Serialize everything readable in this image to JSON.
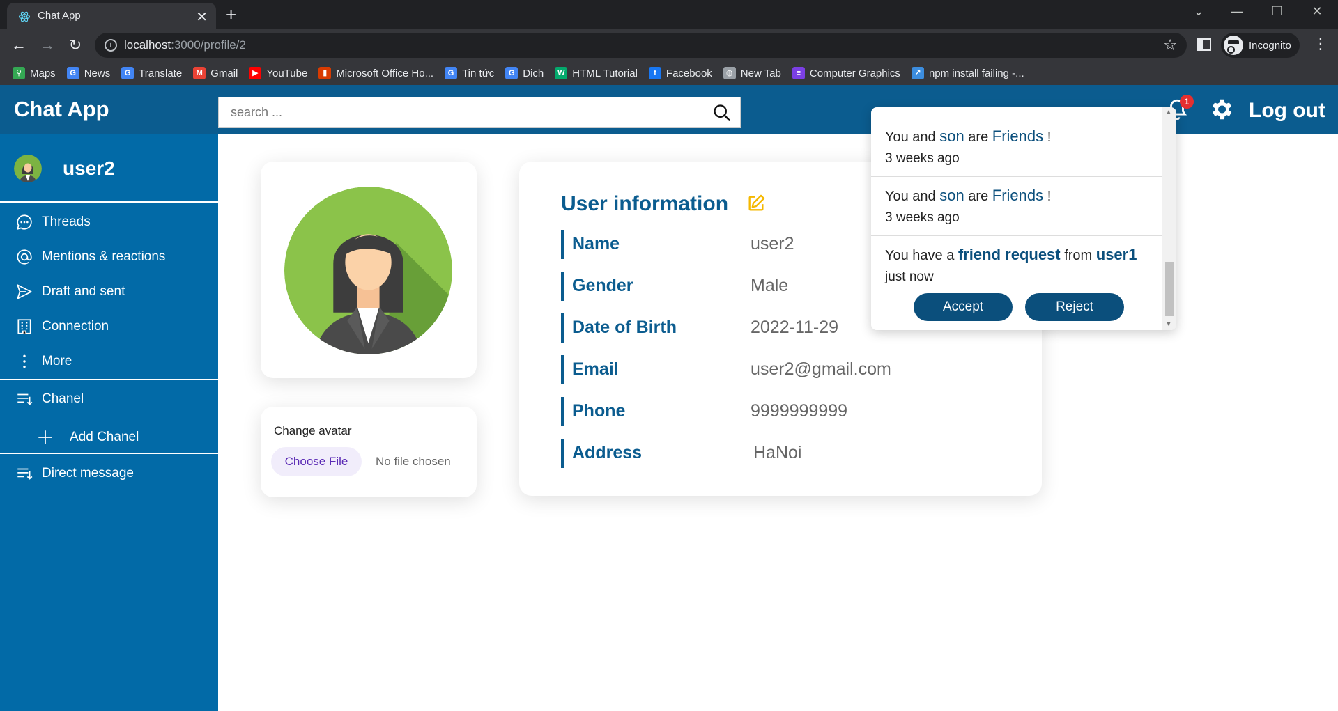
{
  "browser": {
    "tab_title": "Chat App",
    "url_host": "localhost",
    "url_rest": ":3000/profile/2",
    "incognito_label": "Incognito",
    "bookmarks": [
      {
        "label": "Maps",
        "icon": "maps-icon",
        "color": "#34a853"
      },
      {
        "label": "News",
        "icon": "news-icon",
        "color": "#4285f4"
      },
      {
        "label": "Translate",
        "icon": "translate-icon",
        "color": "#4285f4"
      },
      {
        "label": "Gmail",
        "icon": "gmail-icon",
        "color": "#ea4335"
      },
      {
        "label": "YouTube",
        "icon": "youtube-icon",
        "color": "#ff0000"
      },
      {
        "label": "Microsoft Office Ho...",
        "icon": "office-icon",
        "color": "#d83b01"
      },
      {
        "label": "Tin tức",
        "icon": "news-icon",
        "color": "#4285f4"
      },
      {
        "label": "Dich",
        "icon": "translate-icon",
        "color": "#4285f4"
      },
      {
        "label": "HTML Tutorial",
        "icon": "w3schools-icon",
        "color": "#04aa6d"
      },
      {
        "label": "Facebook",
        "icon": "facebook-icon",
        "color": "#1877f2"
      },
      {
        "label": "New Tab",
        "icon": "globe-icon",
        "color": "#9aa0a6"
      },
      {
        "label": "Computer Graphics",
        "icon": "list-icon",
        "color": "#7b3fe4"
      },
      {
        "label": "npm install failing -...",
        "icon": "link-icon",
        "color": "#3c8dde"
      }
    ]
  },
  "header": {
    "brand": "Chat App",
    "search_placeholder": "search ...",
    "notification_count": "1",
    "logout_label": "Log out"
  },
  "sidebar": {
    "username": "user2",
    "items": [
      {
        "label": "Threads",
        "icon": "chat-bubble-icon"
      },
      {
        "label": "Mentions & reactions",
        "icon": "at-sign-icon"
      },
      {
        "label": "Draft and sent",
        "icon": "send-icon"
      },
      {
        "label": "Connection",
        "icon": "building-icon"
      },
      {
        "label": "More",
        "icon": "more-vertical-icon"
      }
    ],
    "channel_label": "Chanel",
    "add_channel_label": "Add Chanel",
    "direct_message_label": "Direct message"
  },
  "avatar_card": {
    "change_label": "Change avatar",
    "choose_file_label": "Choose File",
    "no_file_label": "No file chosen"
  },
  "user_info": {
    "title": "User information",
    "rows": [
      {
        "key": "Name",
        "value": "user2"
      },
      {
        "key": "Gender",
        "value": "Male"
      },
      {
        "key": "Date of Birth",
        "value": "2022-11-29"
      },
      {
        "key": "Email",
        "value": "user2@gmail.com"
      },
      {
        "key": "Phone",
        "value": "9999999999"
      },
      {
        "key": "Address",
        "value": "HaNoi"
      }
    ]
  },
  "notifications": {
    "items": [
      {
        "prefix": "You and",
        "user": "son",
        "mid": "are",
        "status": "Friends",
        "suffix": "!",
        "time": "3 weeks ago"
      },
      {
        "prefix": "You and",
        "user": "son",
        "mid": "are",
        "status": "Friends",
        "suffix": "!",
        "time": "3 weeks ago"
      }
    ],
    "request": {
      "prefix": "You have a",
      "highlight": "friend request",
      "mid": "from",
      "user": "user1",
      "time": "just now",
      "accept_label": "Accept",
      "reject_label": "Reject"
    }
  },
  "colors": {
    "header": "#0b5c8f",
    "sidebar": "#026aa7",
    "accent": "#0b5c8f",
    "badge": "#e52f2f"
  }
}
